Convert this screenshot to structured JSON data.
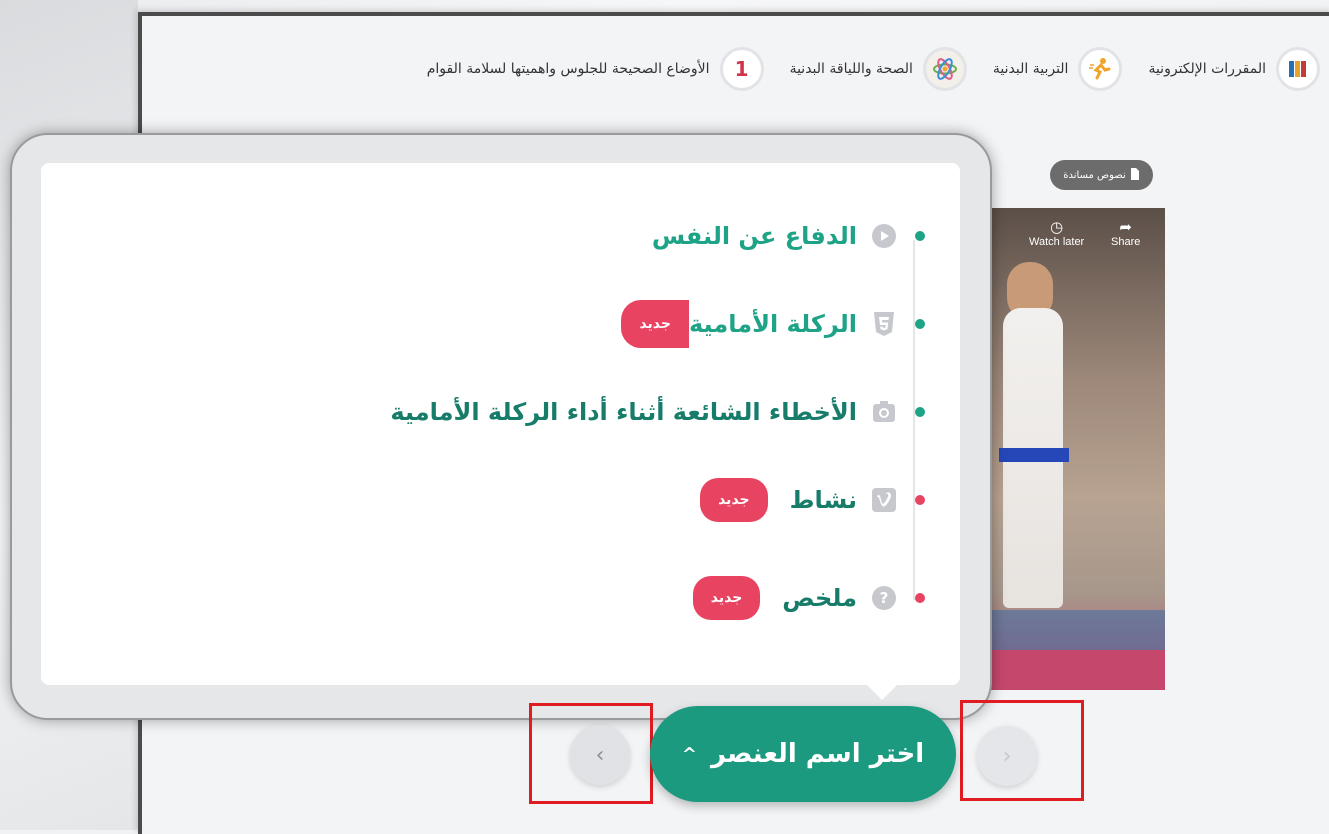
{
  "breadcrumb": [
    {
      "label": "المقررات الإلكترونية",
      "icon": "books-icon"
    },
    {
      "label": "التربية البدنية",
      "icon": "runner-icon"
    },
    {
      "label": "الصحة واللياقة البدنية",
      "icon": "atom-icon"
    },
    {
      "label": "الأوضاع الصحيحة للجلوس واهميتها لسلامة القوام",
      "number": "1"
    }
  ],
  "support_button": {
    "label": "نصوص مساندة",
    "icon": "document-icon"
  },
  "video": {
    "watch_later_label": "Watch later",
    "share_label": "Share"
  },
  "menu": {
    "items": [
      {
        "label": "الدفاع عن النفس",
        "icon": "play-icon",
        "status": "green"
      },
      {
        "label": "الركلة الأمامية",
        "icon": "html5-icon",
        "status": "green",
        "badge": "جديد"
      },
      {
        "label": "الأخطاء الشائعة أثناء أداء الركلة الأمامية",
        "icon": "camera-icon",
        "status": "green"
      },
      {
        "label": "نشاط",
        "icon": "vimeo-icon",
        "status": "red",
        "badge": "جديد"
      },
      {
        "label": "ملخص",
        "icon": "question-icon",
        "status": "red",
        "badge": "جديد"
      }
    ]
  },
  "nav": {
    "select_label": "اختر اسم العنصر",
    "caret": "^",
    "prev_glyph": "‹",
    "next_glyph": "›"
  },
  "colors": {
    "accent_green": "#1b9a7f",
    "badge_red": "#e84360",
    "highlight_box": "#e01b22"
  }
}
